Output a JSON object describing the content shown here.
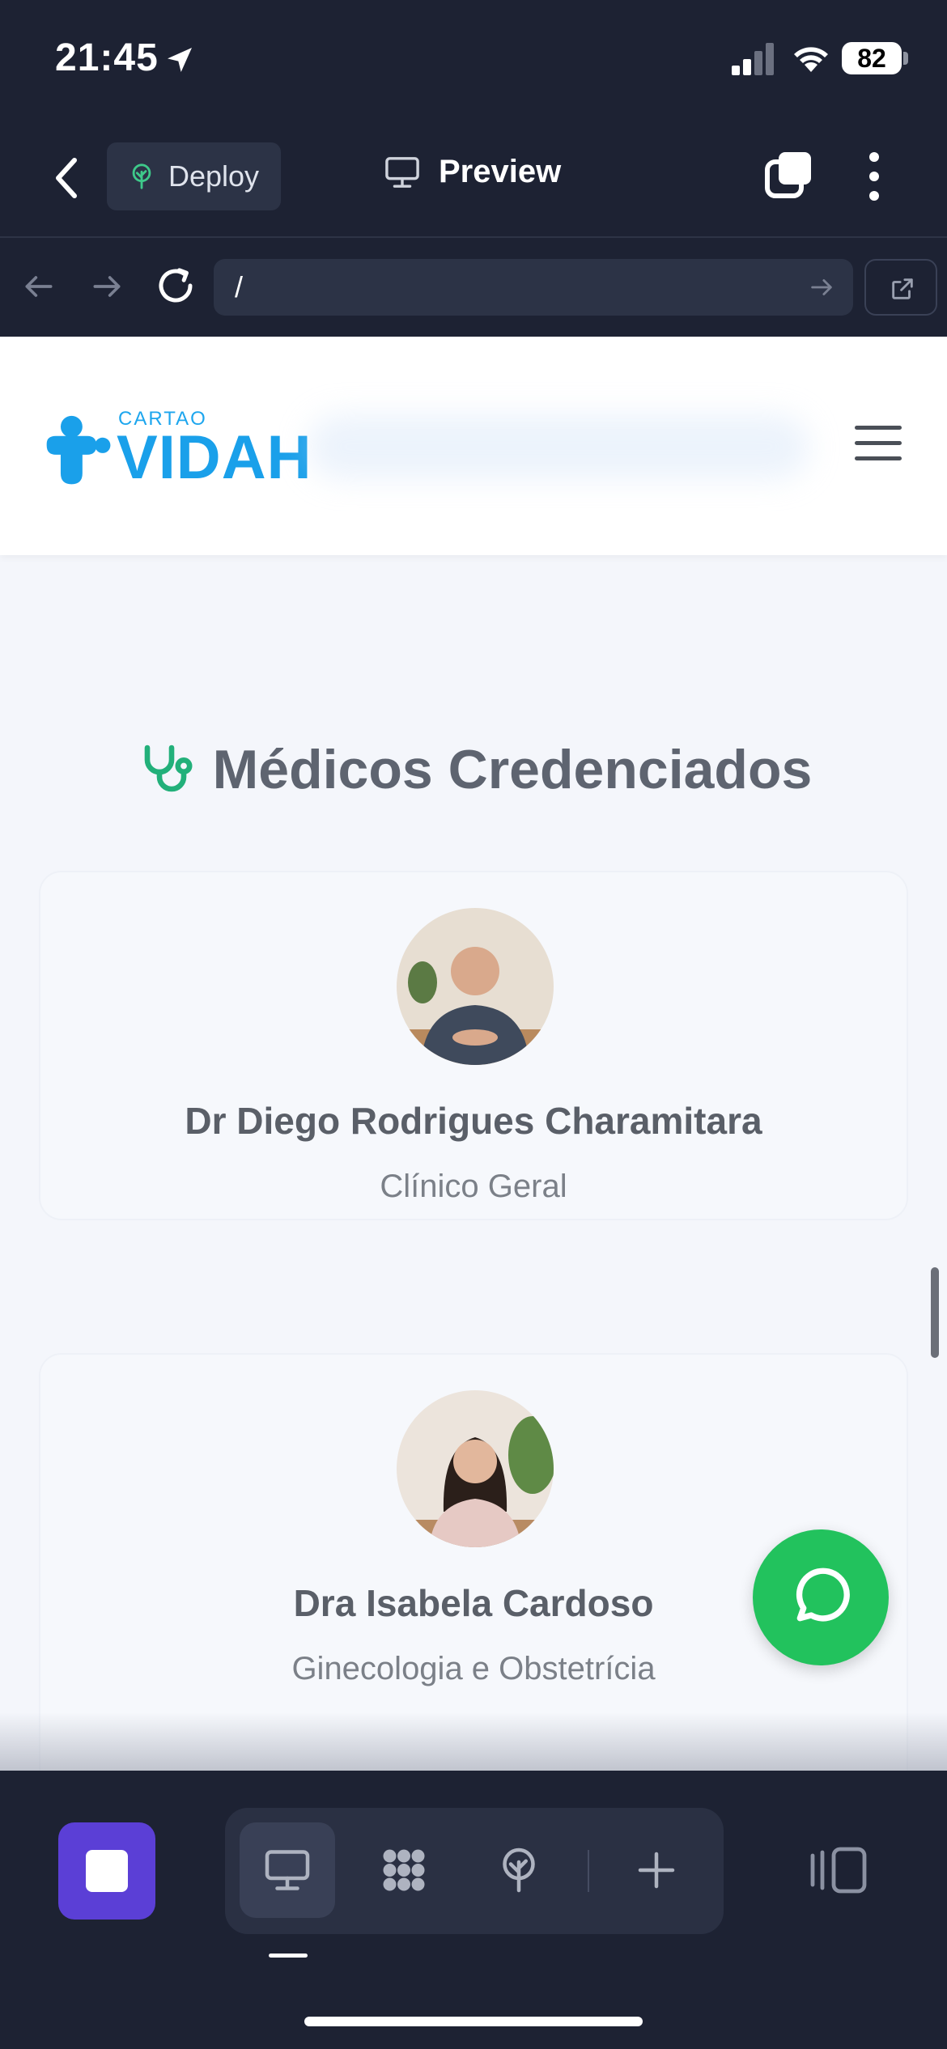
{
  "status_bar": {
    "time": "21:45",
    "battery": "82"
  },
  "header": {
    "deploy_label": "Deploy",
    "preview_label": "Preview"
  },
  "url_bar": {
    "url": "/"
  },
  "site": {
    "logo_small": "CARTAO",
    "logo_big": "VIDAH",
    "section_title": "Médicos Credenciados",
    "doctors": [
      {
        "name": "Dr Diego Rodrigues Charamitara",
        "specialty": "Clínico Geral"
      },
      {
        "name": "Dra Isabela Cardoso",
        "specialty": "Ginecologia e Obstetrícia"
      }
    ]
  },
  "colors": {
    "app_bg": "#1d2233",
    "brand_blue": "#1aa0ea",
    "stethoscope_green": "#22b07a",
    "whatsapp_green": "#22c25d",
    "stop_purple": "#5b3fd6"
  },
  "icons": [
    "location-arrow-icon",
    "signal-icon",
    "wifi-icon",
    "battery-icon",
    "chevron-left-icon",
    "deploy-tree-icon",
    "monitor-icon",
    "tabs-icon",
    "more-vertical-icon",
    "arrow-left-icon",
    "arrow-right-icon",
    "reload-icon",
    "external-link-icon",
    "menu-icon",
    "stethoscope-icon",
    "whatsapp-icon",
    "stop-icon",
    "apps-grid-icon",
    "plus-icon",
    "panel-icon"
  ]
}
